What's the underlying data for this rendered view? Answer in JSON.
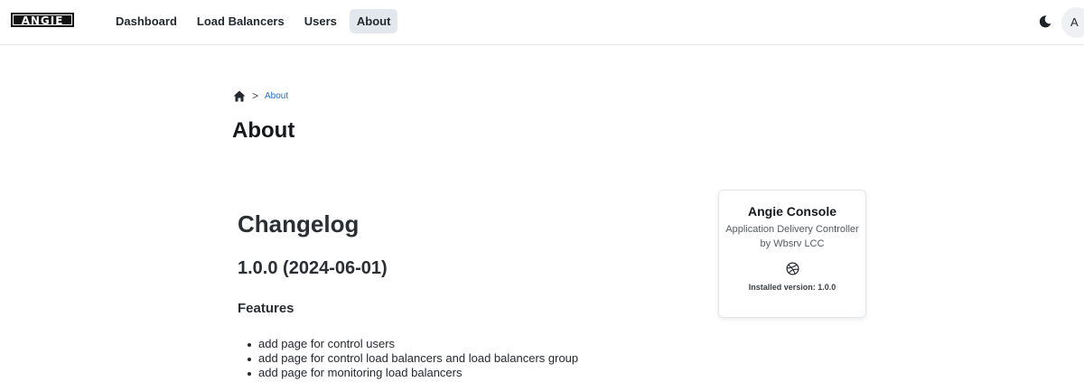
{
  "header": {
    "logo_text": "ANGIE",
    "nav": [
      {
        "label": "Dashboard",
        "active": false
      },
      {
        "label": "Load Balancers",
        "active": false
      },
      {
        "label": "Users",
        "active": false
      },
      {
        "label": "About",
        "active": true
      }
    ],
    "theme_icon": "moon-icon",
    "avatar_initial": "A"
  },
  "breadcrumb": {
    "home_icon": "home-icon",
    "separator": ">",
    "current": "About"
  },
  "page_title": "About",
  "changelog": {
    "title": "Changelog",
    "version_title": "1.0.0 (2024-06-01)",
    "features_title": "Features",
    "features": [
      "add page for control users",
      "add page for control load balancers and load balancers group",
      "add page for monitoring load balancers"
    ]
  },
  "info_card": {
    "title": "Angie Console",
    "subtitle": "Application Delivery Controller by Wbsrv LCC",
    "icon": "dribbble-icon",
    "version": "Installed version: 1.0.0"
  }
}
